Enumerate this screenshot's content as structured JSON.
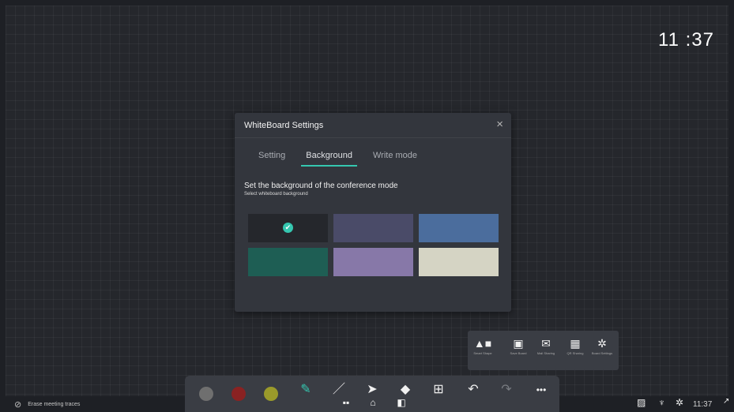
{
  "clock": "11 :37",
  "dialog": {
    "title": "WhiteBoard Settings",
    "close": "×",
    "tabs": [
      {
        "label": "Setting"
      },
      {
        "label": "Background"
      },
      {
        "label": "Write mode"
      }
    ],
    "active_tab": "Background",
    "description": "Set the background of the conference mode",
    "sub_description": "Select whiteboard background",
    "swatches": [
      {
        "color": "#25272c",
        "selected": true
      },
      {
        "color": "#4a4b68",
        "selected": false
      },
      {
        "color": "#4b6d9d",
        "selected": false
      },
      {
        "color": "#1e5e54",
        "selected": false
      },
      {
        "color": "#8778a8",
        "selected": false
      },
      {
        "color": "#d5d4c4",
        "selected": false
      }
    ],
    "check_mark": "✔"
  },
  "tool_panel": {
    "items": [
      {
        "icon": "smart-shape-icon",
        "glyph": "▲■",
        "label": "Smart Shape"
      },
      {
        "icon": "save-icon",
        "glyph": "▣",
        "label": "Save Board"
      },
      {
        "icon": "mail-icon",
        "glyph": "✉",
        "label": "Mail Sharing"
      },
      {
        "icon": "qr-icon",
        "glyph": "▦",
        "label": "QR Sharing"
      },
      {
        "icon": "gear-icon",
        "glyph": "✲",
        "label": "Board Settings"
      }
    ]
  },
  "toolbar": {
    "colors": [
      "#6f6f6f",
      "#8a2222",
      "#9a9a2a"
    ],
    "tools": [
      {
        "icon": "pen-icon",
        "glyph": "✎",
        "label": "Write"
      },
      {
        "icon": "highlighter-icon",
        "glyph": "／",
        "label": "Mark"
      },
      {
        "icon": "select-icon",
        "glyph": "➤",
        "label": "Select"
      },
      {
        "icon": "eraser-icon",
        "glyph": "◆",
        "label": "Erase"
      },
      {
        "icon": "insert-icon",
        "glyph": "⊞",
        "label": "Insert"
      },
      {
        "icon": "undo-icon",
        "glyph": "↶",
        "label": "Undo"
      },
      {
        "icon": "redo-icon",
        "glyph": "↷",
        "label": "Redo"
      },
      {
        "icon": "more-icon",
        "glyph": "•••",
        "label": "More"
      }
    ]
  },
  "nav": [
    {
      "icon": "apps-icon",
      "glyph": "▪▪"
    },
    {
      "icon": "home-icon",
      "glyph": "⌂"
    },
    {
      "icon": "windows-icon",
      "glyph": "◧"
    }
  ],
  "status": {
    "erase_label": "Erase meeting traces",
    "time": "11:37"
  },
  "accent": "#35c7b0"
}
